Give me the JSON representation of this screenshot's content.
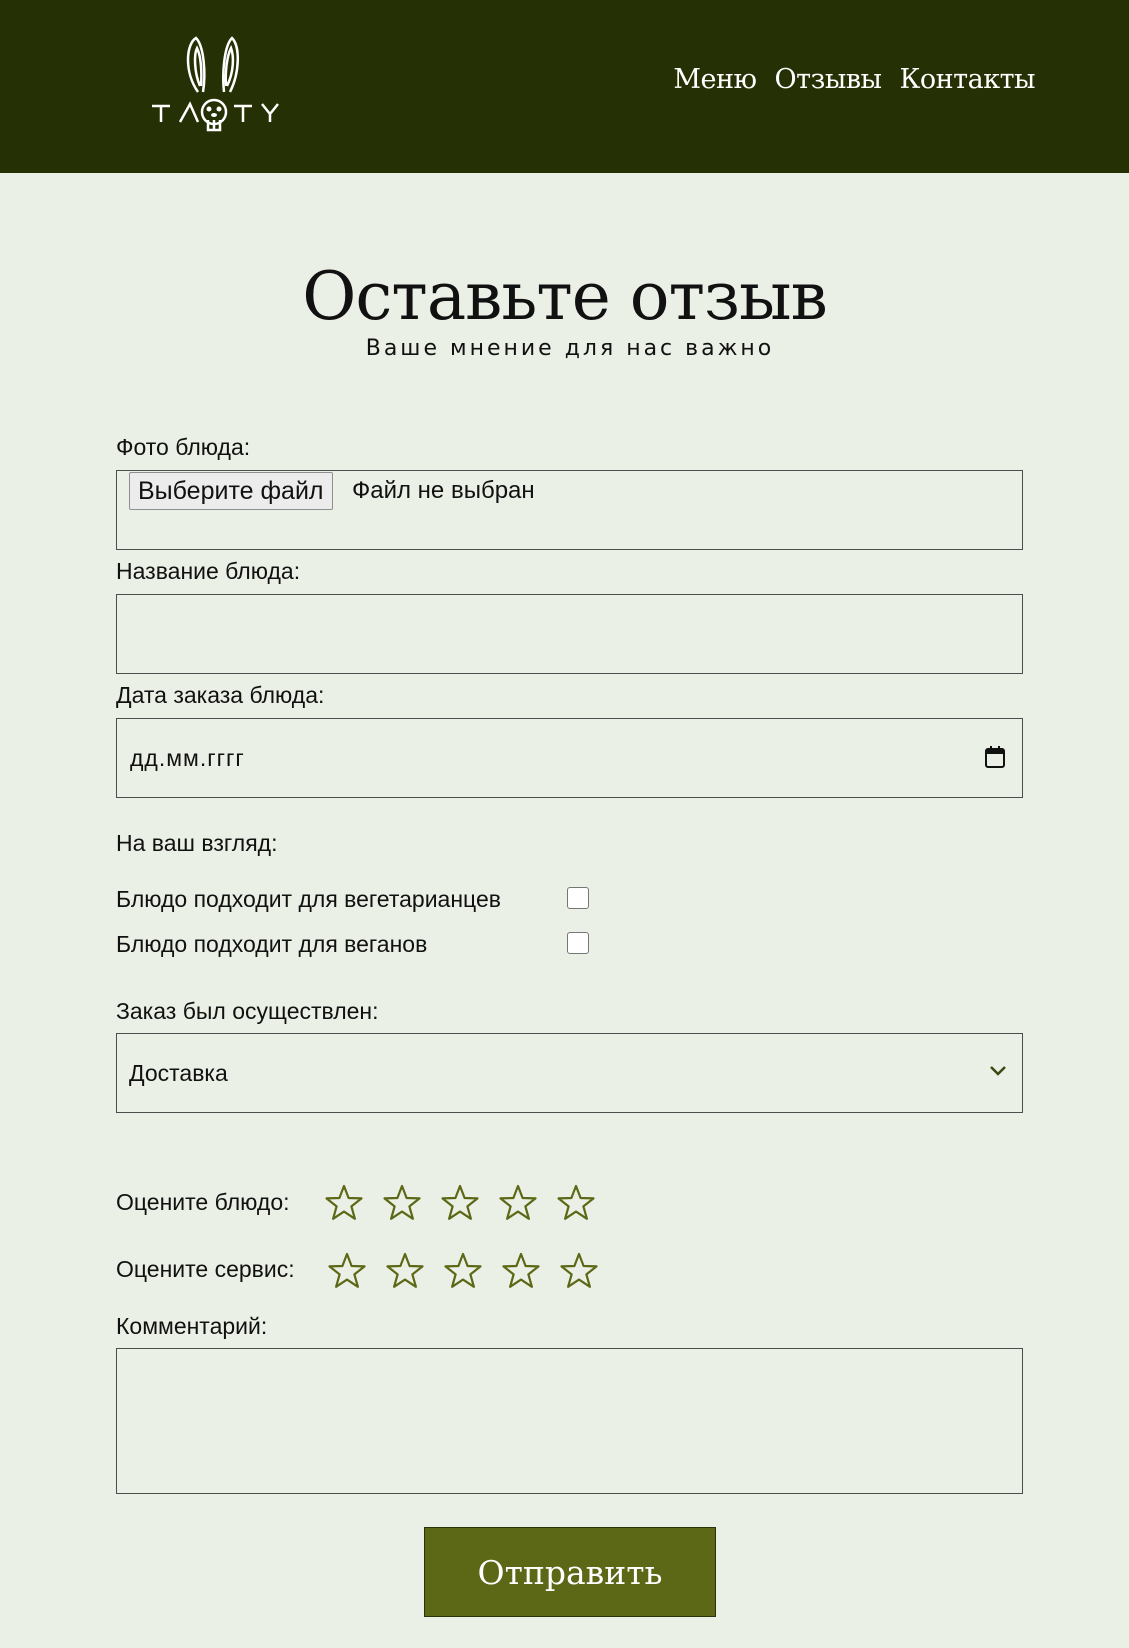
{
  "header": {
    "logo_text": "TASTY",
    "nav": [
      {
        "label": "Меню"
      },
      {
        "label": "Отзывы"
      },
      {
        "label": "Контакты"
      }
    ]
  },
  "page": {
    "title": "Оставьте отзыв",
    "subtitle": "Ваше мнение для нас важно"
  },
  "form": {
    "photo": {
      "label": "Фото блюда:",
      "button_label": "Выберите файл",
      "status": "Файл не выбран"
    },
    "dish_name": {
      "label": "Название блюда:",
      "value": ""
    },
    "order_date": {
      "label": "Дата заказа блюда:",
      "placeholder": "дд.мм.гггг"
    },
    "opinion": {
      "label": "На ваш взгляд:",
      "options": [
        {
          "label": "Блюдо подходит для вегетарианцев",
          "checked": false
        },
        {
          "label": "Блюдо подходит для веганов",
          "checked": false
        }
      ]
    },
    "order_type": {
      "label": "Заказ был осуществлен:",
      "selected": "Доставка"
    },
    "dish_rating": {
      "label": "Оцените блюдо:",
      "value": 0,
      "max": 5
    },
    "service_rating": {
      "label": "Оцените сервис:",
      "value": 0,
      "max": 5
    },
    "comment": {
      "label": "Комментарий:",
      "value": ""
    },
    "submit_label": "Отправить"
  },
  "colors": {
    "header_bg": "#253004",
    "page_bg": "#ebf0e6",
    "accent": "#5c6816",
    "star": "#5c6816"
  },
  "icons": {
    "calendar": "calendar-icon",
    "select": "chevron-down-icon",
    "rating": "star-outline-icon",
    "logo": "rabbit-logo"
  }
}
